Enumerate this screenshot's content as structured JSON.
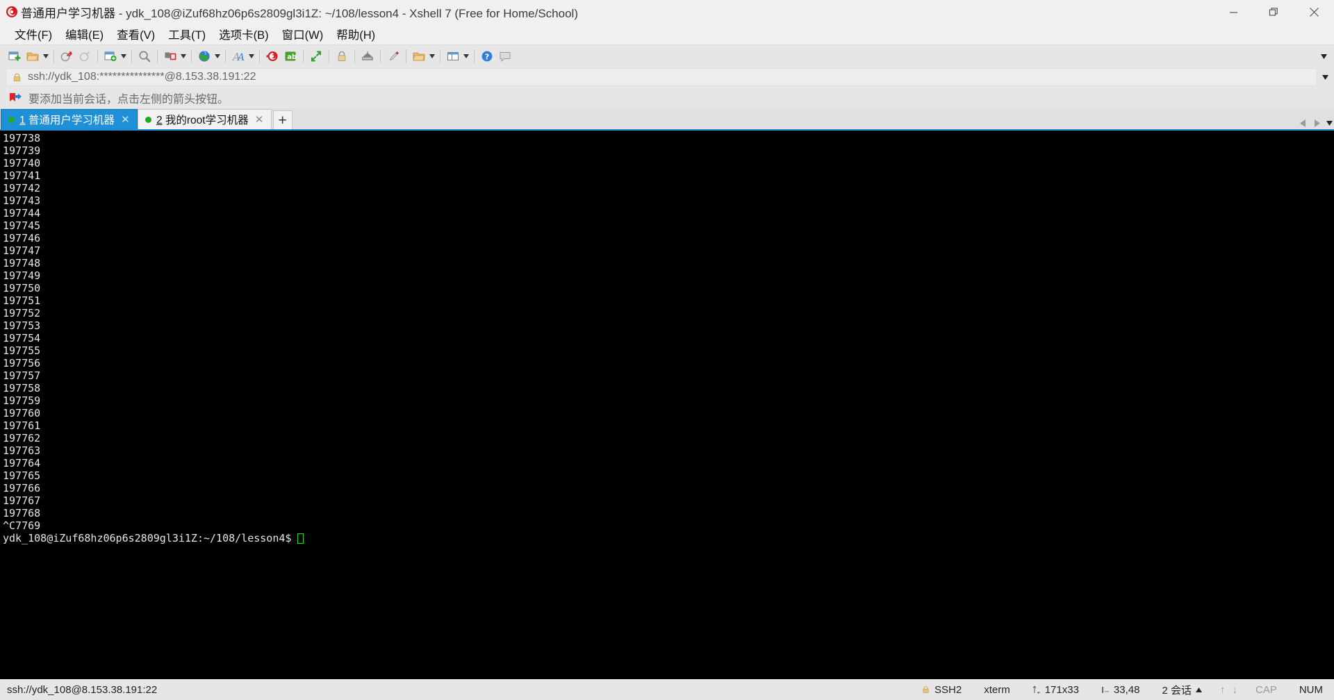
{
  "window": {
    "app_icon": "xshell-logo-icon",
    "title_session": "普通用户学习机器",
    "title_rest": " - ydk_108@iZuf68hz06p6s2809gl3i1Z: ~/108/lesson4 - Xshell 7 (Free for Home/School)",
    "minimize_label": "—",
    "restore_label": "❐",
    "close_label": "✕"
  },
  "menu": {
    "items": [
      {
        "label": "文件(F)",
        "name": "menu-file"
      },
      {
        "label": "编辑(E)",
        "name": "menu-edit"
      },
      {
        "label": "查看(V)",
        "name": "menu-view"
      },
      {
        "label": "工具(T)",
        "name": "menu-tools"
      },
      {
        "label": "选项卡(B)",
        "name": "menu-tabs"
      },
      {
        "label": "窗口(W)",
        "name": "menu-window"
      },
      {
        "label": "帮助(H)",
        "name": "menu-help"
      }
    ]
  },
  "toolbar": {
    "overflow_label": "▾",
    "buttons": [
      {
        "name": "new-session-icon",
        "tooltip": "新建会话"
      },
      {
        "name": "open-folder-icon",
        "tooltip": "打开"
      },
      {
        "name": "disconnect-icon",
        "tooltip": "断开"
      },
      {
        "name": "reconnect-icon",
        "tooltip": "重新连接"
      },
      {
        "name": "new-tab-icon",
        "tooltip": "新建标签"
      },
      {
        "name": "find-icon",
        "tooltip": "查找"
      },
      {
        "name": "layout-icon",
        "tooltip": "排列"
      },
      {
        "name": "globe-icon",
        "tooltip": "会话管理器"
      },
      {
        "name": "font-icon",
        "tooltip": "字体"
      },
      {
        "name": "record-icon",
        "tooltip": "日志记录"
      },
      {
        "name": "highlight-icon",
        "tooltip": "高亮"
      },
      {
        "name": "fullscreen-icon",
        "tooltip": "全屏"
      },
      {
        "name": "lock-icon",
        "tooltip": "锁定"
      },
      {
        "name": "keyboard-icon",
        "tooltip": "键盘"
      },
      {
        "name": "pen-icon",
        "tooltip": "编辑"
      },
      {
        "name": "transfer-icon",
        "tooltip": "文件传输"
      },
      {
        "name": "panel-icon",
        "tooltip": "面板"
      },
      {
        "name": "help-icon",
        "tooltip": "帮助"
      },
      {
        "name": "chat-icon",
        "tooltip": "聊天"
      }
    ]
  },
  "address": {
    "lock_icon": "lock-icon",
    "value": "ssh://ydk_108:***************@8.153.38.191:22",
    "caret": "▾"
  },
  "notice": {
    "icon": "bookmark-arrow-icon",
    "text": "要添加当前会话，点击左侧的箭头按钮。"
  },
  "tabs": {
    "items": [
      {
        "index": "1",
        "label": " 普通用户学习机器",
        "active": true,
        "close": "✕",
        "status": "connected"
      },
      {
        "index": "2",
        "label": " 我的root学习机器",
        "active": false,
        "close": "✕",
        "status": "connected"
      }
    ],
    "add_label": "+",
    "scroll_left": "◀",
    "scroll_right": "▶",
    "menu_caret": "▾"
  },
  "terminal": {
    "lines": [
      "197738",
      "197739",
      "197740",
      "197741",
      "197742",
      "197743",
      "197744",
      "197745",
      "197746",
      "197747",
      "197748",
      "197749",
      "197750",
      "197751",
      "197752",
      "197753",
      "197754",
      "197755",
      "197756",
      "197757",
      "197758",
      "197759",
      "197760",
      "197761",
      "197762",
      "197763",
      "197764",
      "197765",
      "197766",
      "197767",
      "197768",
      "^C7769"
    ],
    "prompt": "ydk_108@iZuf68hz06p6s2809gl3i1Z:~/108/lesson4$",
    "cursor": "block",
    "fg_color": "#e6e6e6",
    "bg_color": "#000000",
    "cursor_color": "#19e019"
  },
  "statusbar": {
    "connection": "ssh://ydk_108@8.153.38.191:22",
    "protocol": "SSH2",
    "term_type": "xterm",
    "size": "171x33",
    "cursor_pos": "33,48",
    "sessions": "2 会话",
    "sessions_caret": "▲",
    "up_arrow": "↑",
    "down_arrow": "↓",
    "cap": "CAP",
    "num": "NUM"
  },
  "colors": {
    "accent": "#1e90d8",
    "tab_active_bg": "#1e90d8",
    "status_green": "#1faa1f",
    "toolbar_bg": "#e6e6e6",
    "chrome_bg": "#f0f0f0"
  }
}
